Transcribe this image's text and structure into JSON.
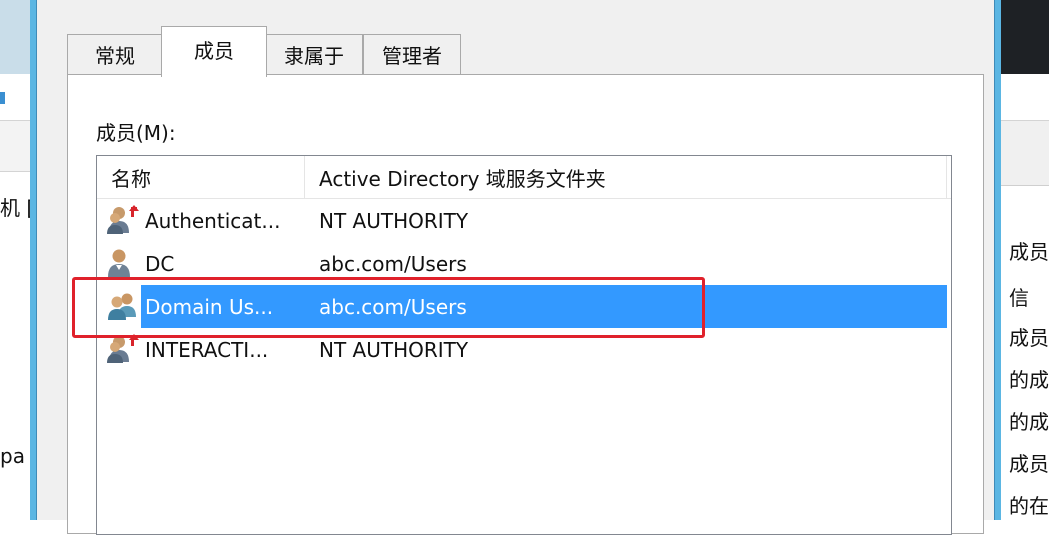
{
  "background_left": {
    "fragments": [
      "机 [",
      "pa"
    ]
  },
  "background_right": {
    "fragments": [
      "成员",
      "信",
      "成员",
      "的成",
      "的成",
      "成员",
      "的在"
    ]
  },
  "dialog": {
    "tabs": [
      {
        "label": "常规",
        "active": false
      },
      {
        "label": "成员",
        "active": true
      },
      {
        "label": "隶属于",
        "active": false
      },
      {
        "label": "管理者",
        "active": false
      }
    ],
    "members_label": "成员(M):",
    "list": {
      "columns": [
        "名称",
        "Active Directory 域服务文件夹"
      ],
      "rows": [
        {
          "name": "Authenticat...",
          "folder": "NT AUTHORITY",
          "icon": "special-group-icon",
          "selected": false
        },
        {
          "name": "DC",
          "folder": "abc.com/Users",
          "icon": "user-icon",
          "selected": false
        },
        {
          "name": "Domain Us...",
          "folder": "abc.com/Users",
          "icon": "group-icon",
          "selected": true
        },
        {
          "name": "INTERACTI...",
          "folder": "NT AUTHORITY",
          "icon": "special-group-icon",
          "selected": false
        }
      ]
    }
  },
  "colors": {
    "dialog_border": "#5bb6e3",
    "selection": "#3399ff",
    "annotation": "#e0212b"
  }
}
